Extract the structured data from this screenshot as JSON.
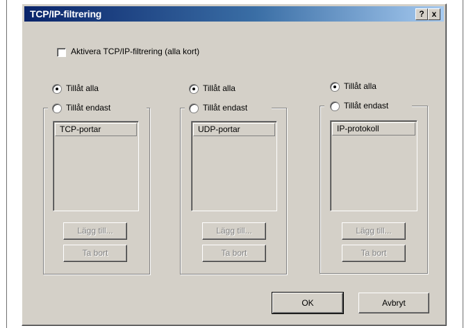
{
  "window": {
    "title": "TCP/IP-filtrering",
    "help_label": "?",
    "close_label": "x"
  },
  "enable_filter": {
    "label": "Aktivera TCP/IP-filtrering (alla kort)",
    "checked": false
  },
  "groups": [
    {
      "allow_all_label": "Tillåt alla",
      "allow_only_label": "Tillåt endast",
      "selected": "allow_all",
      "list_header": "TCP-portar",
      "add_label": "Lägg till...",
      "remove_label": "Ta bort"
    },
    {
      "allow_all_label": "Tillåt alla",
      "allow_only_label": "Tillåt endast",
      "selected": "allow_all",
      "list_header": "UDP-portar",
      "add_label": "Lägg till...",
      "remove_label": "Ta bort"
    },
    {
      "allow_all_label": "Tillåt alla",
      "allow_only_label": "Tillåt endast",
      "selected": "allow_all",
      "list_header": "IP-protokoll",
      "add_label": "Lägg till...",
      "remove_label": "Ta bort"
    }
  ],
  "buttons": {
    "ok_label": "OK",
    "cancel_label": "Avbryt"
  }
}
